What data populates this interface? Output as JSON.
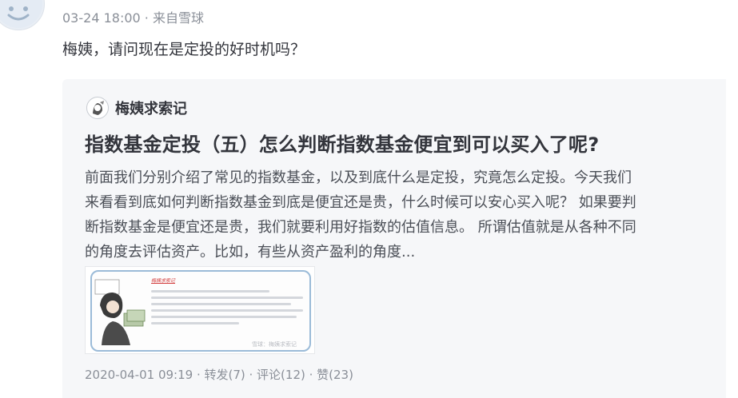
{
  "post": {
    "timestamp": "03-24 18:00",
    "separator": "·",
    "source": "来自雪球",
    "text": "梅姨，请问现在是定投的好时机吗？"
  },
  "card": {
    "author": "梅姨求索记",
    "title": "指数基金定投（五）怎么判断指数基金便宜到可以买入了呢?",
    "body_lines": [
      "前面我们分别介绍了常见的指数基金，以及到底什么是定投，究竟怎么定投。今天我们",
      "来看看到底如何判断指数基金到底是便宜还是贵，什么时候可以安心买入呢？ 如果要判",
      "断指数基金是便宜还是贵，我们就要利用好指数的估值信息。 所谓估值就是从各种不同",
      "的角度去评估资产。比如，有些从资产盈利的角度..."
    ],
    "thumbnail": {
      "title": "梅姨求索记",
      "watermark": "雪球：梅姨求索记"
    },
    "footer": {
      "date": "2020-04-01 09:19",
      "sep": " · ",
      "repost": "转发(7)",
      "comment": "评论(12)",
      "like": "赞(23)"
    }
  }
}
